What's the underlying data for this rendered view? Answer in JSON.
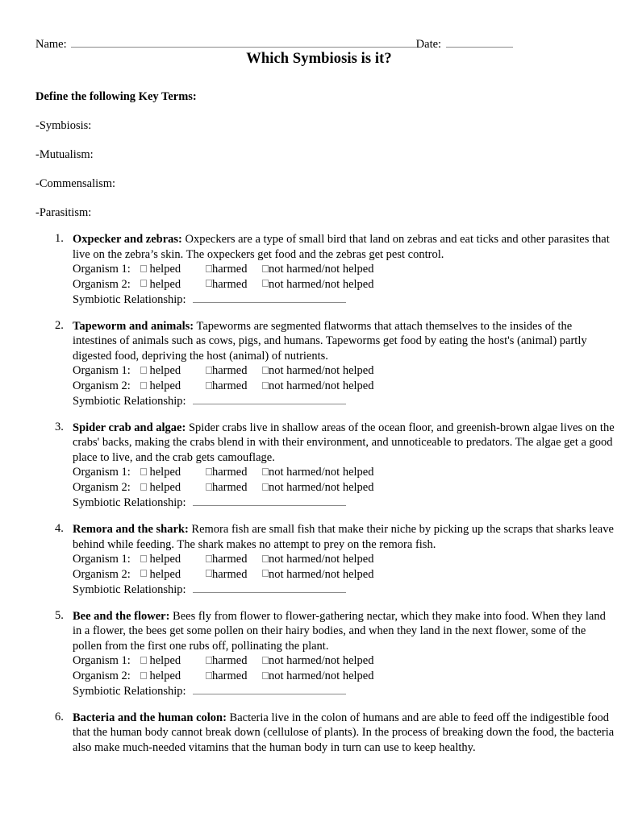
{
  "header": {
    "name_label": "Name:",
    "date_label": "Date:"
  },
  "title": "Which Symbiosis is it?",
  "key_terms": {
    "heading": "Define the following Key Terms:",
    "terms": [
      "-Symbiosis:",
      "-Mutualism:",
      "-Commensalism:",
      "-Parasitism:"
    ]
  },
  "labels": {
    "organism_1": "Organism 1:",
    "organism_2": "Organism 2:",
    "option_helped": "helped",
    "option_harmed": "harmed",
    "option_not_harmed": "not harmed/not helped",
    "symbiotic_relationship": "Symbiotic Relationship:"
  },
  "questions": [
    {
      "number": "1.",
      "lead": "Oxpecker and zebras:",
      "description": " Oxpeckers are a type of small bird that land on zebras and eat ticks and other parasites that live on the zebra’s skin. The oxpeckers get food and the zebras get pest control.",
      "has_options": true
    },
    {
      "number": "2.",
      "lead": "Tapeworm and animals:",
      "description": " Tapeworms are segmented flatworms that attach themselves to the insides of the intestines of animals such as cows, pigs, and humans. Tapeworms get food by eating the host's (animal) partly digested food, depriving the host (animal) of nutrients.",
      "has_options": true
    },
    {
      "number": "3.",
      "lead": "Spider crab and algae:",
      "description": " Spider crabs live in shallow areas of the ocean floor, and greenish-brown algae lives on the crabs' backs, making the crabs blend in with their environment, and unnoticeable to predators. The algae get a good place to live, and the crab gets camouflage.",
      "has_options": true
    },
    {
      "number": "4.",
      "lead": "Remora and the shark:",
      "description": " Remora fish are small fish that make their niche by picking up the scraps that sharks leave behind while feeding.  The shark makes no attempt to prey on the remora fish.",
      "has_options": true
    },
    {
      "number": "5.",
      "lead": "Bee and the flower:",
      "description": " Bees fly from flower to flower-gathering nectar, which they make into food.  When they land in a flower, the bees get some pollen on their hairy bodies, and when they land in the next flower, some of the pollen from the first one rubs off, pollinating the plant.",
      "has_options": true
    },
    {
      "number": "6.",
      "lead": "Bacteria and the human colon:",
      "description": " Bacteria live in the colon of humans and are able to feed off the indigestible food that the human body cannot break down (cellulose of plants).  In the process of breaking down the food, the bacteria also make much-needed vitamins that the human body in turn can use to keep healthy.",
      "has_options": false
    }
  ],
  "colors": {
    "text": "#000000",
    "rule": "#8a8a8a",
    "checkbox_border": "#9d9d9d",
    "page_background": "#ffffff"
  }
}
